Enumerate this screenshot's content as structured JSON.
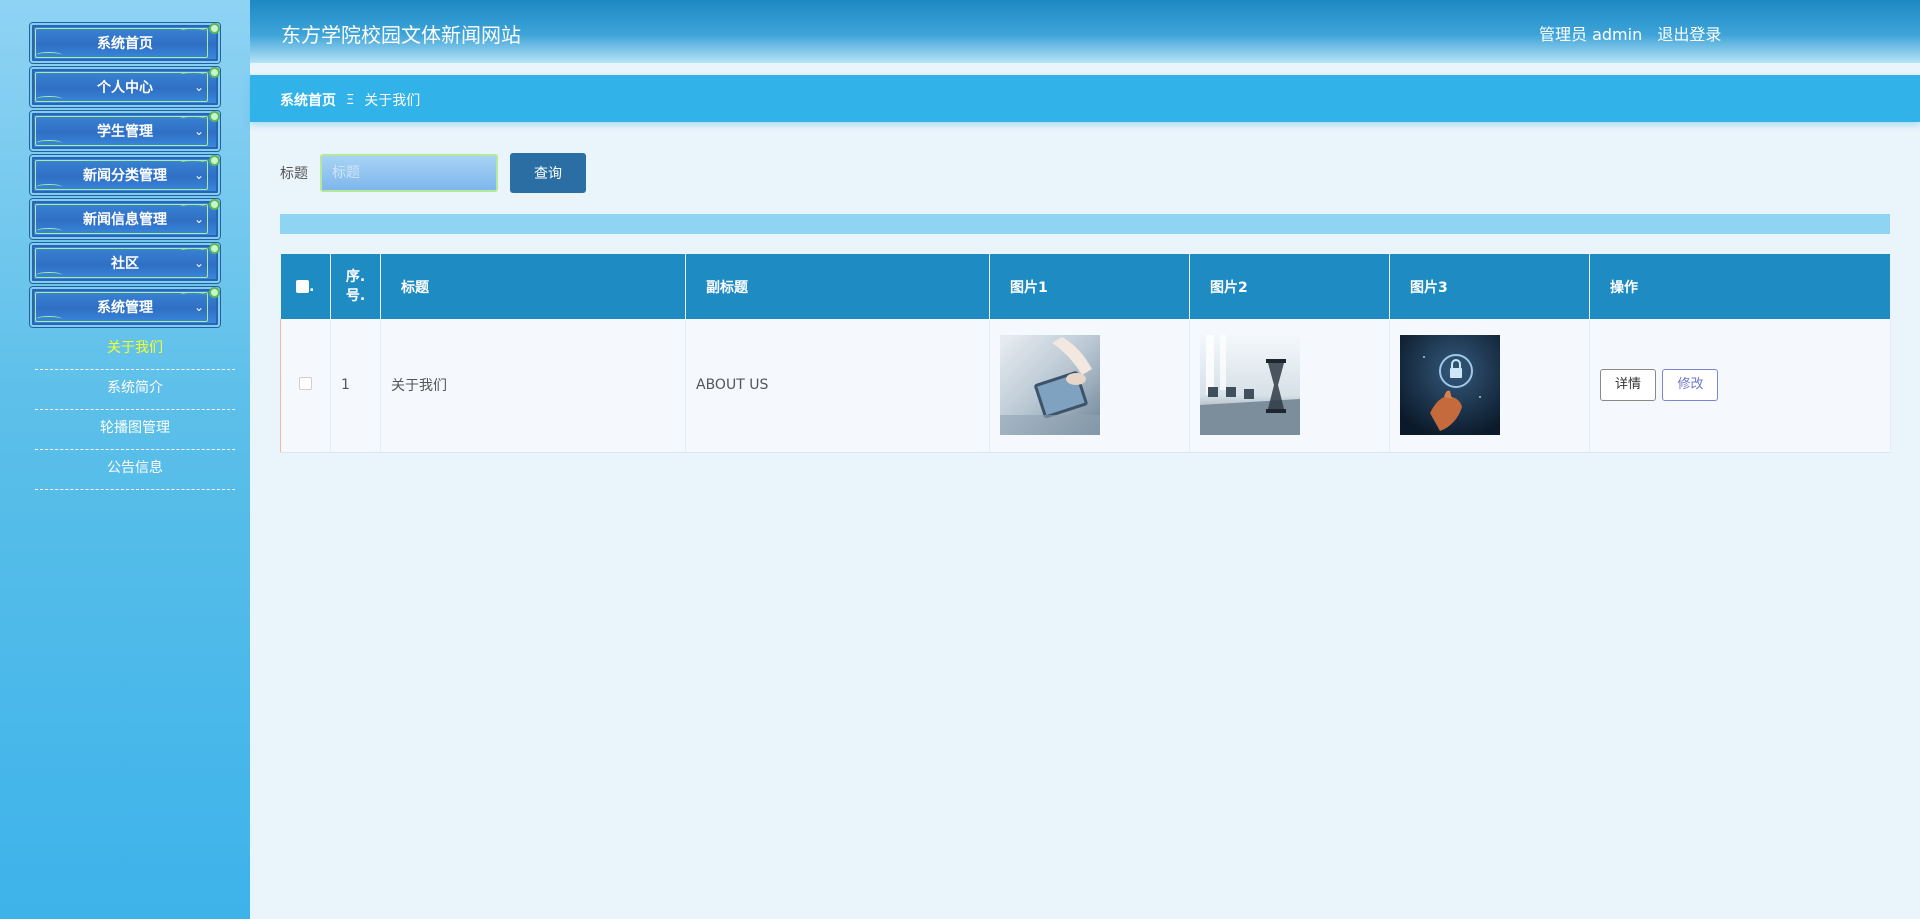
{
  "header": {
    "site_title": "东方学院校园文体新闻网站",
    "user": "管理员 admin",
    "logout": "退出登录"
  },
  "sidebar": {
    "menu": [
      {
        "label": "系统首页",
        "has_chevron": false
      },
      {
        "label": "个人中心",
        "has_chevron": true
      },
      {
        "label": "学生管理",
        "has_chevron": true
      },
      {
        "label": "新闻分类管理",
        "has_chevron": true
      },
      {
        "label": "新闻信息管理",
        "has_chevron": true
      },
      {
        "label": "社区",
        "has_chevron": true
      },
      {
        "label": "系统管理",
        "has_chevron": true
      }
    ],
    "submenu": [
      {
        "label": "关于我们",
        "active": true
      },
      {
        "label": "系统简介",
        "active": false
      },
      {
        "label": "轮播图管理",
        "active": false
      },
      {
        "label": "公告信息",
        "active": false
      }
    ]
  },
  "breadcrumb": {
    "home": "系统首页",
    "separator": "Ξ",
    "current": "关于我们"
  },
  "search": {
    "label": "标题",
    "placeholder": "标题",
    "value": "",
    "button": "查询"
  },
  "table": {
    "headers": {
      "select": ".",
      "index": "序.\n号.",
      "title": "标题",
      "subtitle": "副标题",
      "pic1": "图片1",
      "pic2": "图片2",
      "pic3": "图片3",
      "action": "操作"
    },
    "rows": [
      {
        "index": "1",
        "title": "关于我们",
        "subtitle": "ABOUT US",
        "pic1": "business-tablet-image",
        "pic2": "meeting-room-hourglass-image",
        "pic3": "security-lock-hand-image",
        "detail_button": "详情",
        "edit_button": "修改"
      }
    ]
  },
  "colors": {
    "header": "#1e88c4",
    "breadcrumb_bar": "#31b3ea",
    "table_header": "#1e8bc3",
    "search_button": "#2a6ea3",
    "active_submenu": "#f3ff2a",
    "info_strip": "#8fd4f2"
  }
}
